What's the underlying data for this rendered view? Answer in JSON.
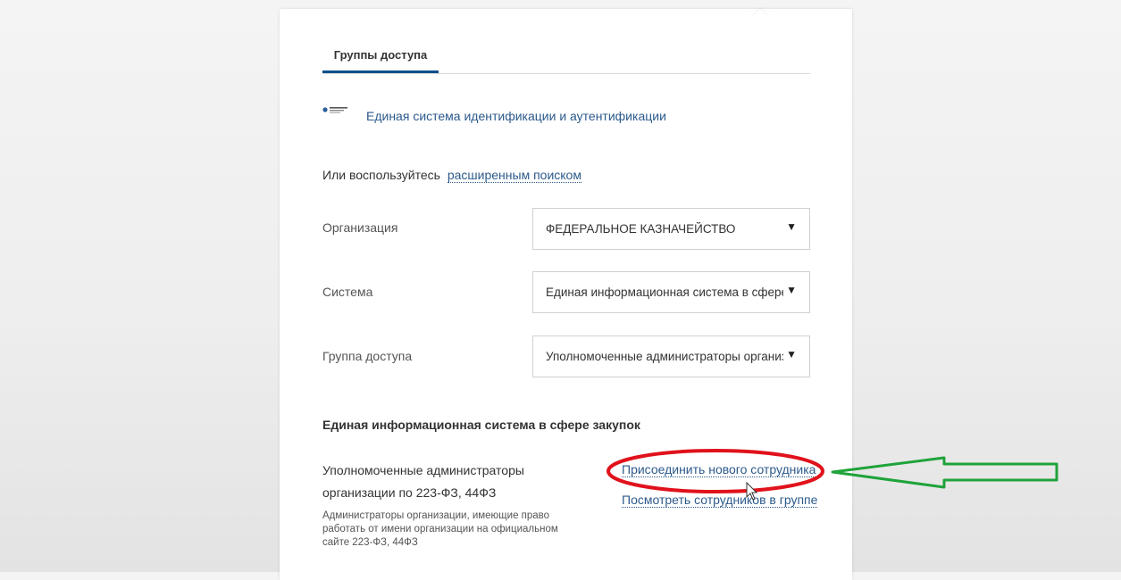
{
  "tabs": [
    {
      "label": "Группы доступа",
      "active": true
    }
  ],
  "system_link": {
    "label": "Единая система идентификации и аутентификации",
    "logo_icon": "esia-logo-icon"
  },
  "advanced_search": {
    "prefix": "Или воспользуйтесь",
    "link": "расширенным поиском"
  },
  "fields": {
    "organization": {
      "label": "Организация",
      "value": "ФЕДЕРАЛЬНОЕ КАЗНАЧЕЙСТВО"
    },
    "system": {
      "label": "Система",
      "value": "Единая информационная система в сфере"
    },
    "access_group": {
      "label": "Группа доступа",
      "value": "Уполномоченные администраторы организ"
    }
  },
  "section": {
    "title": "Единая информационная система в сфере закупок",
    "group_name": "Уполномоченные администраторы организации по 223-ФЗ, 44ФЗ",
    "group_desc": "Администраторы организации, имеющие право работать от имени организации на официальном сайте 223-ФЗ, 44ФЗ",
    "actions": {
      "join": "Присоединить нового сотрудника",
      "view": "Посмотреть сотрудников в группе"
    }
  },
  "colors": {
    "accent": "#0d4f8b",
    "link": "#2c5a8c",
    "highlight_ellipse": "#e0121b",
    "annotation_arrow": "#1fa33a"
  },
  "icons": {
    "dropdown": "▼"
  }
}
